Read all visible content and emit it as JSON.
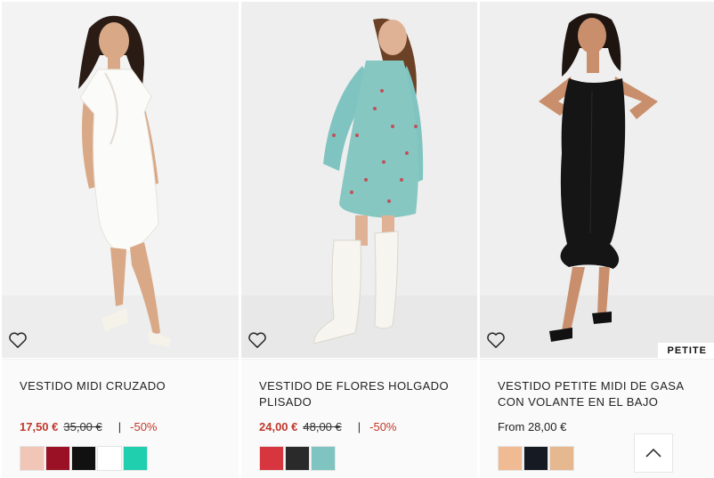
{
  "products": [
    {
      "title": "VESTIDO MIDI CRUZADO",
      "price_sale": "17,50 €",
      "price_was": "35,00 €",
      "separator": "|",
      "discount": "-50%",
      "swatches": [
        "#f1c6b6",
        "#9a1024",
        "#111111",
        "#ffffff",
        "#1fcfae"
      ]
    },
    {
      "title": "VESTIDO DE FLORES HOLGADO PLISADO",
      "price_sale": "24,00 €",
      "price_was": "48,00 €",
      "separator": "|",
      "discount": "-50%",
      "swatches": [
        "#d8363f",
        "#2a2a2a",
        "#7fc4c0"
      ]
    },
    {
      "title": "VESTIDO PETITE MIDI DE GASA CON VOLANTE EN EL BAJO",
      "price_from": "From 28,00 €",
      "badge": "PETITE",
      "swatches": [
        "#f0bb92",
        "#161a22",
        "#e5b88f"
      ]
    }
  ],
  "icons": {
    "wishlist": "heart-outline-icon",
    "back_to_top": "chevron-up-icon"
  }
}
